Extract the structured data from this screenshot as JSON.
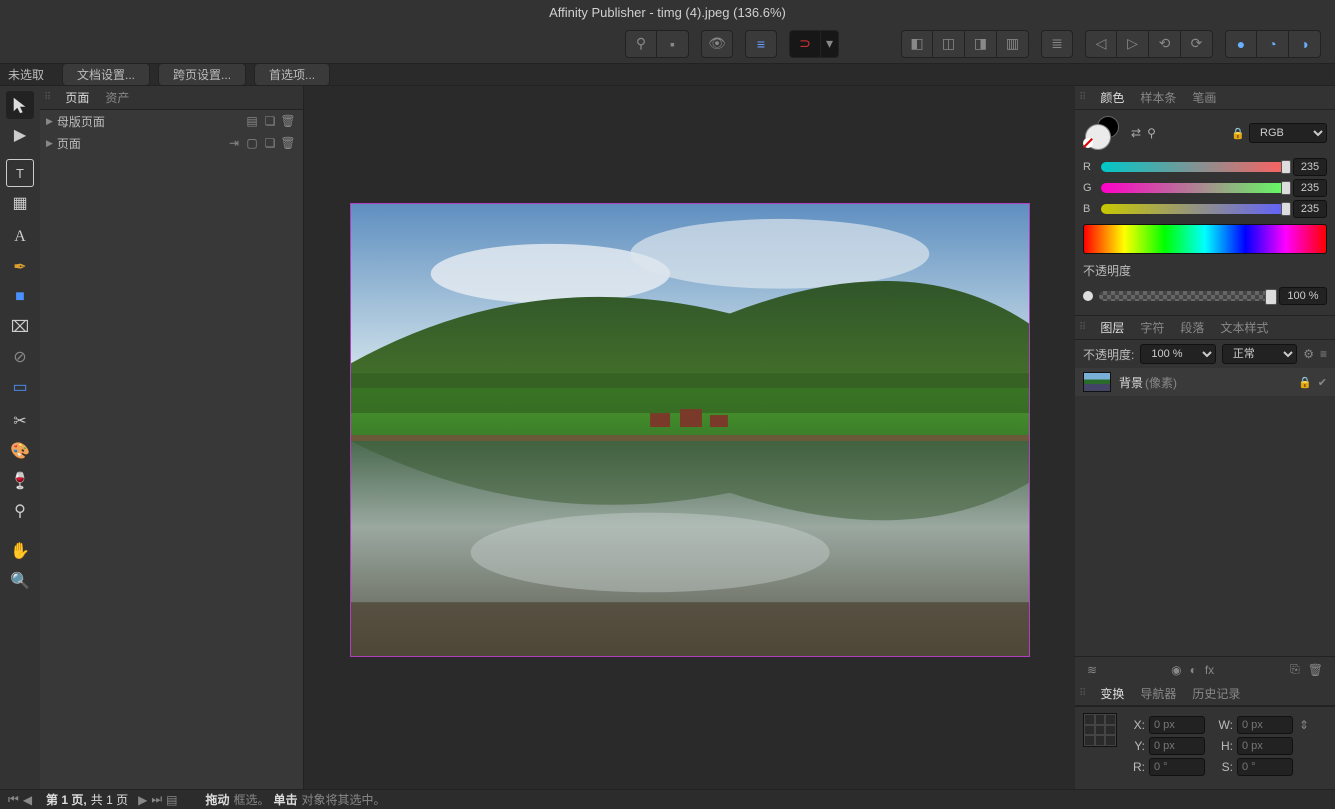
{
  "titlebar": "Affinity Publisher - timg (4).jpeg (136.6%)",
  "context": {
    "label": "未选取",
    "buttons": [
      "文档设置...",
      "跨页设置...",
      "首选项..."
    ]
  },
  "pages_panel": {
    "tabs": [
      "页面",
      "资产"
    ],
    "rows": [
      {
        "label": "母版页面"
      },
      {
        "label": "页面"
      }
    ]
  },
  "color_panel": {
    "tabs": [
      "颜色",
      "样本条",
      "笔画"
    ],
    "mode": "RGB",
    "channels": {
      "R": "235",
      "G": "235",
      "B": "235"
    },
    "opacity_label": "不透明度",
    "opacity_value": "100 %"
  },
  "layers_panel": {
    "tabs": [
      "图层",
      "字符",
      "段落",
      "文本样式"
    ],
    "opacity_label": "不透明度:",
    "opacity_value": "100 %",
    "blend": "正常",
    "layer_name": "背景",
    "layer_paren": "(像素)"
  },
  "transform_panel": {
    "tabs": [
      "变换",
      "导航器",
      "历史记录"
    ],
    "X": "0 px",
    "Y": "0 px",
    "W": "0 px",
    "H": "0 px",
    "R_label": "R:",
    "R": "0 °",
    "S_label": "S:",
    "S": "0 °"
  },
  "status": {
    "page_info_bold": "第 1 页,",
    "page_info_rest": "共 1 页",
    "hint_bold1": "拖动",
    "hint_rest1": "框选。",
    "hint_bold2": "单击",
    "hint_rest2": "对象将其选中。"
  }
}
